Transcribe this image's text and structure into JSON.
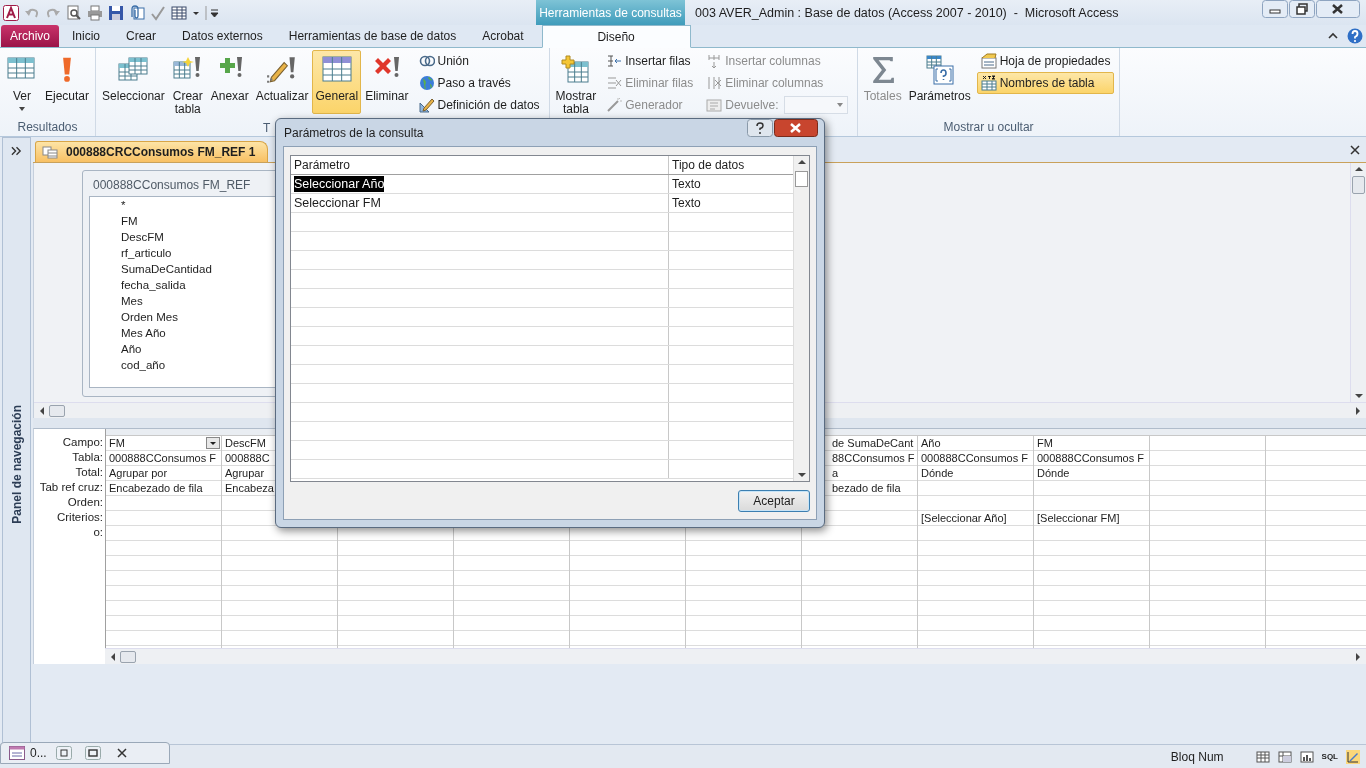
{
  "title_bar": {
    "context_label": "Herramientas de consultas",
    "title": "003 AVER_Admin : Base de datos (Access 2007 - 2010)  -  Microsoft Access"
  },
  "ribbon_tabs": [
    {
      "label": "Archivo",
      "kind": "file",
      "selected": false
    },
    {
      "label": "Inicio",
      "kind": "normal",
      "selected": false
    },
    {
      "label": "Crear",
      "kind": "normal",
      "selected": false
    },
    {
      "label": "Datos externos",
      "kind": "normal",
      "selected": false
    },
    {
      "label": "Herramientas de base de datos",
      "kind": "normal",
      "selected": false
    },
    {
      "label": "Acrobat",
      "kind": "normal",
      "selected": false
    },
    {
      "label": "Diseño",
      "kind": "context",
      "selected": true
    }
  ],
  "ribbon_groups": [
    {
      "label": "Resultados",
      "items": [
        {
          "label": "Ver",
          "kind": "large",
          "disabled": false,
          "selected": false
        },
        {
          "label": "Ejecutar",
          "kind": "large",
          "disabled": false,
          "selected": false
        }
      ]
    },
    {
      "label": "T",
      "items": [
        {
          "label": "Seleccionar",
          "kind": "large",
          "disabled": false,
          "selected": false
        },
        {
          "label": "Crear tabla",
          "kind": "large",
          "disabled": false,
          "selected": false
        },
        {
          "label": "Anexar",
          "kind": "large",
          "disabled": false,
          "selected": false
        },
        {
          "label": "Actualizar",
          "kind": "large",
          "disabled": false,
          "selected": false
        },
        {
          "label": "General",
          "kind": "large",
          "disabled": false,
          "selected": true
        },
        {
          "label": "Eliminar",
          "kind": "large",
          "disabled": false,
          "selected": false
        },
        {
          "label": "Unión",
          "kind": "small",
          "disabled": false,
          "selected": false
        },
        {
          "label": "Paso a través",
          "kind": "small",
          "disabled": false,
          "selected": false
        },
        {
          "label": "Definición de datos",
          "kind": "small",
          "disabled": false,
          "selected": false
        }
      ]
    },
    {
      "items": [
        {
          "label": "Mostrar tabla",
          "kind": "large",
          "disabled": false,
          "selected": false
        },
        {
          "label": "Insertar filas",
          "kind": "small",
          "disabled": false,
          "selected": false
        },
        {
          "label": "Eliminar filas",
          "kind": "small",
          "disabled": true,
          "selected": false
        },
        {
          "label": "Generador",
          "kind": "small",
          "disabled": true,
          "selected": false
        },
        {
          "label": "Insertar columnas",
          "kind": "small",
          "disabled": true,
          "selected": false
        },
        {
          "label": "Eliminar columnas",
          "kind": "small",
          "disabled": true,
          "selected": false
        },
        {
          "label": "Devuelve:",
          "kind": "combo",
          "disabled": true,
          "selected": false
        }
      ]
    },
    {
      "label": "Mostrar u ocultar",
      "items": [
        {
          "label": "Totales",
          "kind": "large",
          "disabled": true,
          "selected": false
        },
        {
          "label": "Parámetros",
          "kind": "large",
          "disabled": false,
          "selected": false
        },
        {
          "label": "Hoja de propiedades",
          "kind": "small",
          "disabled": false,
          "selected": false
        },
        {
          "label": "Nombres de tabla",
          "kind": "small",
          "disabled": false,
          "selected": true
        }
      ]
    }
  ],
  "navigation_pane": {
    "label": "Panel de navegación"
  },
  "document_tab": {
    "label": "000888CRCConsumos FM_REF 1"
  },
  "table_box": {
    "title": "000888CConsumos FM_REF",
    "fields": [
      "*",
      "FM",
      "DescFM",
      "rf_articulo",
      "SumaDeCantidad",
      "fecha_salida",
      "Mes",
      "Orden Mes",
      "Mes Año",
      "Año",
      "cod_año"
    ]
  },
  "design_grid": {
    "row_labels": [
      "Campo:",
      "Tabla:",
      "Total:",
      "Tab ref cruz:",
      "Orden:",
      "Criterios:",
      "o:"
    ],
    "columns": [
      {
        "cells": [
          {
            "text": "FM",
            "kind": "dropdown"
          },
          "000888CConsumos F",
          "Agrupar por",
          "Encabezado de fila",
          null,
          null,
          null
        ]
      },
      {
        "cells": [
          "DescFM",
          "000888C",
          "Agrupar",
          "Encabeza",
          null,
          null,
          null
        ]
      },
      {
        "cells": [
          null,
          null,
          null,
          null,
          null,
          null,
          null
        ]
      },
      {
        "cells": [
          null,
          null,
          null,
          null,
          null,
          null,
          null
        ]
      },
      {
        "cells": [
          null,
          null,
          null,
          null,
          null,
          null,
          null
        ]
      },
      {
        "cells": [
          null,
          null,
          null,
          null,
          null,
          null,
          null
        ]
      },
      {
        "cells": [
          "de SumaDeCant",
          "88CConsumos F",
          "a",
          "bezado de fila",
          null,
          null,
          null
        ]
      },
      {
        "cells": [
          "Año",
          "000888CConsumos F",
          "Dónde",
          null,
          null,
          "[Seleccionar Año]",
          null
        ]
      },
      {
        "cells": [
          "FM",
          "000888CConsumos F",
          "Dónde",
          null,
          null,
          "[Seleccionar FM]",
          null
        ]
      },
      {
        "cells": [
          null,
          null,
          null,
          null,
          null,
          null,
          null
        ]
      },
      {
        "cells": [
          null,
          null,
          null,
          null,
          null,
          null,
          null
        ]
      }
    ]
  },
  "dialog": {
    "title": "Parámetros de la consulta",
    "columns": [
      "Parámetro",
      "Tipo de datos"
    ],
    "rows": [
      {
        "name": "Seleccionar Año",
        "type": "Texto",
        "selected": true
      },
      {
        "name": "Seleccionar FM",
        "type": "Texto",
        "selected": false
      }
    ],
    "ok_button": "Aceptar"
  },
  "minimized_window": {
    "label": "0..."
  },
  "status_bar": {
    "indicator": "Bloq Num",
    "views": [
      {
        "kind": "datasheet",
        "selected": false
      },
      {
        "kind": "pivot-table",
        "selected": false
      },
      {
        "kind": "pivot-chart",
        "selected": false
      },
      {
        "kind": "sql",
        "label": "SQL",
        "selected": false
      },
      {
        "kind": "design",
        "selected": true
      }
    ]
  }
}
